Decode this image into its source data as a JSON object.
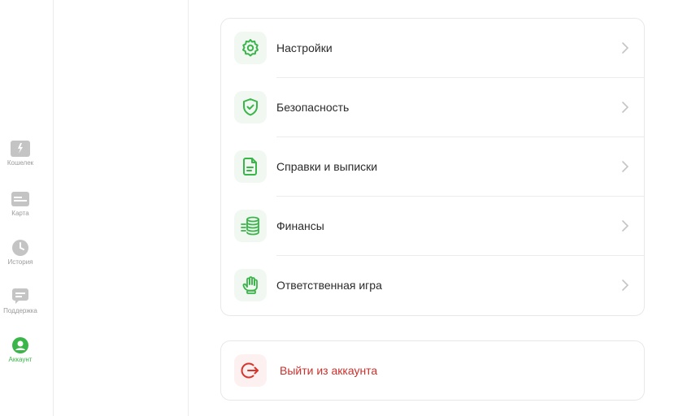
{
  "nav": {
    "items": [
      {
        "label": "Кошелек",
        "icon": "wallet-icon",
        "active": false
      },
      {
        "label": "Карта",
        "icon": "card-icon",
        "active": false
      },
      {
        "label": "История",
        "icon": "clock-icon",
        "active": false
      },
      {
        "label": "Поддержка",
        "icon": "chat-icon",
        "active": false
      },
      {
        "label": "Аккаунт",
        "icon": "account-icon",
        "active": true
      }
    ]
  },
  "menu": {
    "items": [
      {
        "label": "Настройки",
        "icon": "gear-icon"
      },
      {
        "label": "Безопасность",
        "icon": "shield-check-icon"
      },
      {
        "label": "Справки и выписки",
        "icon": "document-icon"
      },
      {
        "label": "Финансы",
        "icon": "coins-icon"
      },
      {
        "label": "Ответственная игра",
        "icon": "hand-icon"
      }
    ]
  },
  "logout": {
    "label": "Выйти из аккаунта",
    "icon": "logout-icon"
  },
  "colors": {
    "accent": "#3ab54a",
    "danger": "#c9302c",
    "inactive": "#c4c4c4"
  }
}
